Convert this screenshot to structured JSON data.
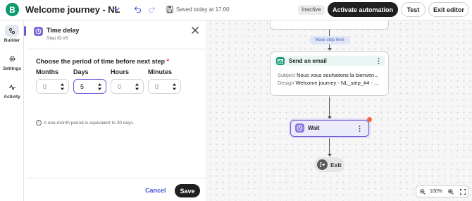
{
  "header": {
    "logo_letter": "B",
    "title": "Welcome journey - NL",
    "saved_text": "Saved today at 17:00",
    "status_badge": "Inactive",
    "activate_label": "Activate automation",
    "test_label": "Test",
    "exit_label": "Exit editor"
  },
  "rail": {
    "items": [
      {
        "label": "Builder",
        "icon": "builder-icon",
        "active": true
      },
      {
        "label": "Settings",
        "icon": "gear-icon",
        "active": false
      },
      {
        "label": "Activity",
        "icon": "activity-icon",
        "active": false
      }
    ]
  },
  "panel": {
    "title": "Time delay",
    "step_id": "Step ID #5",
    "question": "Choose the period of time before next step",
    "required_mark": "*",
    "fields": [
      {
        "label": "Months",
        "value": "0",
        "focused": false
      },
      {
        "label": "Days",
        "value": "5",
        "focused": true
      },
      {
        "label": "Hours",
        "value": "0",
        "focused": false
      },
      {
        "label": "Minutes",
        "value": "0",
        "focused": false
      }
    ],
    "note": "A one-month period is equivalent to 30 days.",
    "cancel_label": "Cancel",
    "save_label": "Save"
  },
  "canvas": {
    "move_here_label": "Move step here",
    "email_node": {
      "title": "Send an email",
      "subject_key": "Subject",
      "subject_value": "Nous vous souhaitons la bienven...",
      "design_key": "Design",
      "design_value": "Welcome journey - NL_step_#4 - ..."
    },
    "wait_node": {
      "title": "Wait"
    },
    "exit_node": {
      "title": "Exit"
    },
    "zoom_level": "100%"
  },
  "colors": {
    "brand": "#0b996e",
    "accent": "#6f5bd6",
    "email_green": "#1c9a7a",
    "alert_dot": "#f06b3a",
    "link": "#4a57d6"
  }
}
